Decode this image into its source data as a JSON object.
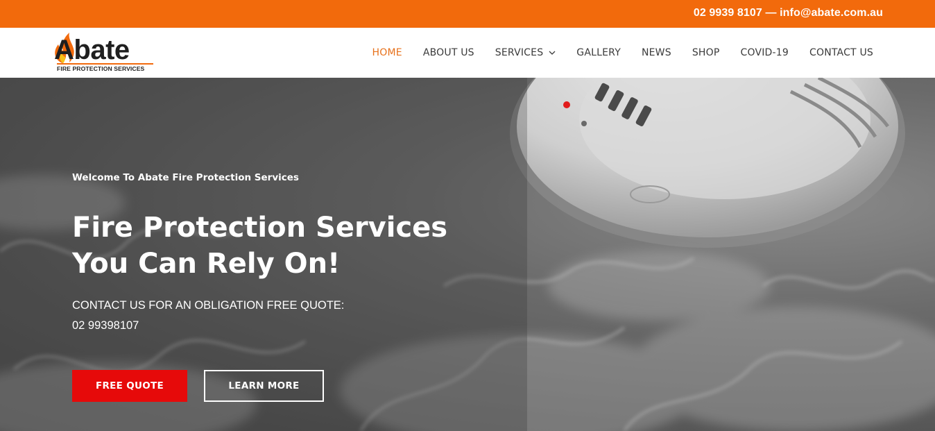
{
  "topbar": {
    "contact": "02 9939 8107 — info@abate.com.au"
  },
  "logo": {
    "word": "Abate",
    "tagline": "FIRE PROTECTION SERVICES"
  },
  "nav": {
    "items": [
      {
        "label": "HOME",
        "active": true
      },
      {
        "label": "ABOUT US"
      },
      {
        "label": "SERVICES",
        "has_dropdown": true
      },
      {
        "label": "GALLERY"
      },
      {
        "label": "NEWS"
      },
      {
        "label": "SHOP"
      },
      {
        "label": "COVID-19"
      },
      {
        "label": "CONTACT US"
      }
    ]
  },
  "hero": {
    "eyebrow": "Welcome To Abate Fire Protection Services",
    "headline_line1": "Fire Protection Services",
    "headline_line2": "You Can Rely On!",
    "sub_line1": "CONTACT US FOR AN OBLIGATION FREE QUOTE:",
    "sub_line2": "02 99398107",
    "primary_button": "FREE QUOTE",
    "secondary_button": "LEARN MORE",
    "image": "smoke-detector-in-smoke"
  },
  "colors": {
    "brand_orange": "#f26a0c",
    "nav_active": "#e7711b",
    "cta_red": "#e60a0a"
  }
}
